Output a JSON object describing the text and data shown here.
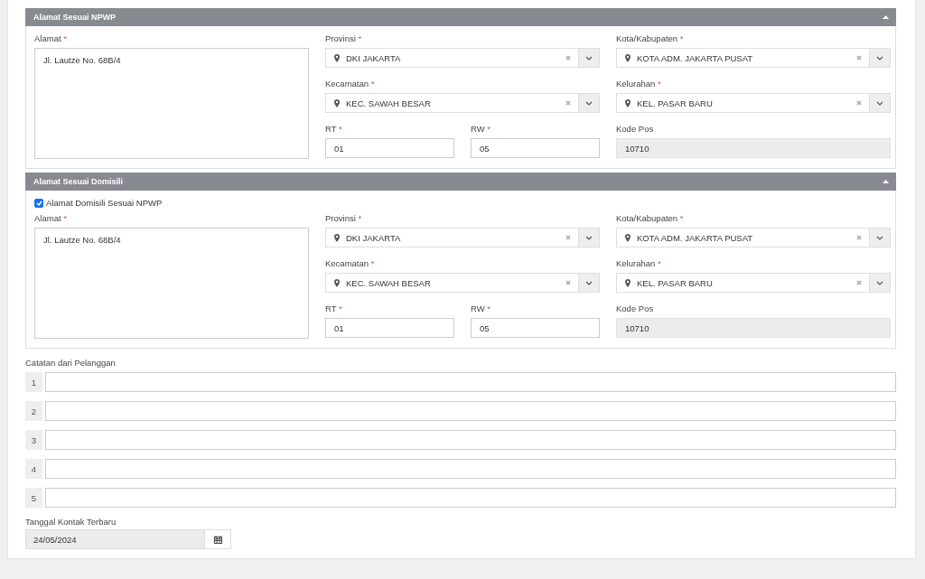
{
  "sections": [
    {
      "title": "Alamat Sesuai NPWP",
      "expanded": true,
      "alamat": {
        "label": "Alamat",
        "required_mark": "*",
        "value": "Jl. Lautze No. 68B/4"
      },
      "column_2": [
        [
          {
            "label": "Provinsi",
            "required_mark": "*",
            "value": "DKI JAKARTA",
            "kind": "select"
          }
        ],
        [
          {
            "label": "Kecamatan",
            "required_mark": "*",
            "value": "KEC. SAWAH BESAR",
            "kind": "select"
          }
        ],
        [
          {
            "label": "RT",
            "required_mark": "*",
            "value": "01",
            "kind": "text"
          },
          {
            "label": "RW",
            "required_mark": "*",
            "value": "05",
            "kind": "text"
          }
        ]
      ],
      "column_3": [
        [
          {
            "label": "Kota/Kabupaten",
            "required_mark": "*",
            "value": "KOTA ADM. JAKARTA PUSAT",
            "kind": "select"
          }
        ],
        [
          {
            "label": "Kelurahan",
            "required_mark": "*",
            "value": "KEL. PASAR BARU",
            "kind": "select"
          }
        ],
        [
          {
            "label": "Kode Pos",
            "value": "10710",
            "kind": "readonly"
          }
        ]
      ]
    },
    {
      "title": "Alamat Sesuai Domisili",
      "expanded": true,
      "checkbox": {
        "label": "Alamat Domisili Sesuai NPWP",
        "checked": true
      },
      "alamat": {
        "label": "Alamat",
        "required_mark": "*",
        "value": "Jl. Lautze No. 68B/4"
      },
      "column_2": [
        [
          {
            "label": "Provinsi",
            "required_mark": "*",
            "value": "DKI JAKARTA",
            "kind": "select"
          }
        ],
        [
          {
            "label": "Kecamatan",
            "required_mark": "*",
            "value": "KEC. SAWAH BESAR",
            "kind": "select"
          }
        ],
        [
          {
            "label": "RT",
            "required_mark": "*",
            "value": "01",
            "kind": "text"
          },
          {
            "label": "RW",
            "required_mark": "*",
            "value": "05",
            "kind": "text"
          }
        ]
      ],
      "column_3": [
        [
          {
            "label": "Kota/Kabupaten",
            "required_mark": "*",
            "value": "KOTA ADM. JAKARTA PUSAT",
            "kind": "select"
          }
        ],
        [
          {
            "label": "Kelurahan",
            "required_mark": "*",
            "value": "KEL. PASAR BARU",
            "kind": "select"
          }
        ],
        [
          {
            "label": "Kode Pos",
            "value": "10710",
            "kind": "readonly"
          }
        ]
      ]
    }
  ],
  "notes": {
    "label": "Catatan dari Pelanggan",
    "rows": [
      "1",
      "2",
      "3",
      "4",
      "5"
    ]
  },
  "last_contact": {
    "label": "Tanggal Kontak Terbaru",
    "value": "24/05/2024"
  }
}
